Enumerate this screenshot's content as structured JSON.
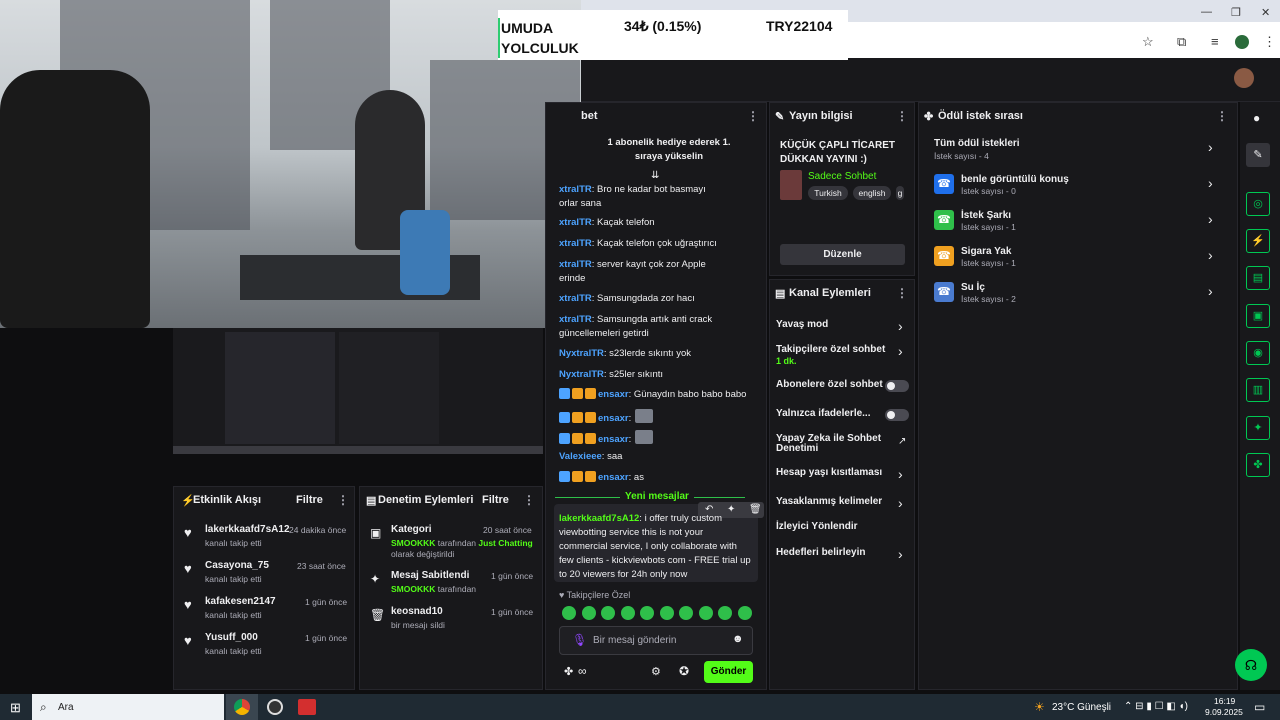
{
  "overlay": {
    "name_line1": "UMUDA",
    "name_line2": "YOLCULUK",
    "change": "34₺ (0.15%)",
    "ticker": "TRY22104"
  },
  "chat": {
    "pinned": "1 abonelik hediye ederek 1. sıraya yükselin",
    "title_fragment": "bet",
    "lines": [
      {
        "nick": "xtralTR",
        "text": ": Bro ne kadar bot basmayı",
        "cont": "orlar sana"
      },
      {
        "nick": "xtralTR",
        "text": ": Kaçak telefon"
      },
      {
        "nick": "xtralTR",
        "text": ": Kaçak telefon çok uğraştırıcı"
      },
      {
        "nick": "xtralTR",
        "text": ": server kayıt çok zor Apple",
        "cont": "erinde"
      },
      {
        "nick": "xtralTR",
        "text": ": Samsungdada zor hacı"
      },
      {
        "nick": "xtralTR",
        "text": ": Samsungda artık anti crack",
        "cont": "güncellemeleri getirdi"
      },
      {
        "nick": "NyxtralTR",
        "text": ": s23lerde sıkıntı yok"
      },
      {
        "nick": "NyxtralTR",
        "text": ": s25ler sıkıntı"
      },
      {
        "nick": "ensaxr",
        "text": ": Günaydın babo babo babo"
      },
      {
        "nick": "ensaxr",
        "text": ":"
      },
      {
        "nick": "ensaxr",
        "text": ":"
      },
      {
        "nick": "Valexieee",
        "text": ": saa"
      },
      {
        "nick": "ensaxr",
        "text": ": as"
      }
    ],
    "new_messages": "Yeni mesajlar",
    "spam": {
      "nick": "lakerkkaafd7sA12",
      "text": ": i offer truly custom viewbotting service this is not your commercial service, I only collaborate with few clients - kickviewbots com - FREE trial up to 20 viewers for 24h only now"
    },
    "followers_label": "♥ Takipçilere Özel",
    "input_placeholder": "Bir mesaj gönderin",
    "send": "Gönder",
    "points": "∞"
  },
  "stream_info": {
    "header": "Yayın bilgisi",
    "title": "KÜÇÜK ÇAPLI TİCARET DÜKKAN YAYINI :)",
    "category": "Sadece Sohbet",
    "tags": [
      "Turkish",
      "english",
      "g"
    ],
    "edit": "Düzenle"
  },
  "channel_actions": {
    "header": "Kanal Eylemleri",
    "items": [
      {
        "label": "Yavaş mod"
      },
      {
        "label": "Takipçilere özel sohbet",
        "sub": "1 dk."
      },
      {
        "label": "Abonelere özel sohbet"
      },
      {
        "label": "Yalnızca ifadelerle..."
      },
      {
        "label": "Yapay Zeka ile Sohbet Denetimi"
      },
      {
        "label": "Hesap yaşı kısıtlaması"
      },
      {
        "label": "Yasaklanmış kelimeler"
      },
      {
        "label": "İzleyici Yönlendir"
      },
      {
        "label": "Hedefleri belirleyin"
      }
    ]
  },
  "rewards": {
    "header": "Ödül istek sırası",
    "all": {
      "label": "Tüm ödül istekleri",
      "sub": "İstek sayısı - 4"
    },
    "items": [
      {
        "label": "benle görüntülü konuş",
        "sub": "İstek sayısı - 0",
        "color": "#1f6feb"
      },
      {
        "label": "İstek Şarkı",
        "sub": "İstek sayısı - 1",
        "color": "#2fbf4a"
      },
      {
        "label": "Sigara Yak",
        "sub": "İstek sayısı - 1",
        "color": "#f0a020"
      },
      {
        "label": "Su İç",
        "sub": "İstek sayısı - 2",
        "color": "#4a7bd0"
      }
    ]
  },
  "activity": {
    "header": "Etkinlik Akışı",
    "filter": "Filtre",
    "items": [
      {
        "name": "lakerkkaafd7sA12",
        "sub": "kanalı takip etti",
        "time": "24 dakika önce"
      },
      {
        "name": "Casayona_75",
        "sub": "kanalı takip etti",
        "time": "23 saat önce"
      },
      {
        "name": "kafakesen2147",
        "sub": "kanalı takip etti",
        "time": "1 gün önce"
      },
      {
        "name": "Yusuff_000",
        "sub": "kanalı takip etti",
        "time": "1 gün önce"
      }
    ]
  },
  "moderation": {
    "header": "Denetim Eylemleri",
    "filter": "Filtre",
    "items": [
      {
        "title": "Kategori",
        "user": "SMOOKKK",
        "mid": " tarafından ",
        "extra": "Just Chatting",
        "line2": "olarak değiştirildi",
        "time": "20 saat önce"
      },
      {
        "title": "Mesaj Sabitlendi",
        "user": "SMOOKKK",
        "mid": " tarafından",
        "extra": "",
        "line2": "",
        "time": "1 gün önce"
      },
      {
        "title": "keosnad10",
        "user": "",
        "mid": "",
        "extra": "",
        "line2": "bir mesajı sildi",
        "time": "1 gün önce"
      }
    ]
  },
  "taskbar": {
    "search": "Ara",
    "weather": "23°C Güneşli",
    "time": "16:19",
    "date": "9.09.2025"
  },
  "colors": {
    "accent": "#53fc18",
    "bg": "#0e0e10",
    "panel": "#18181b"
  }
}
